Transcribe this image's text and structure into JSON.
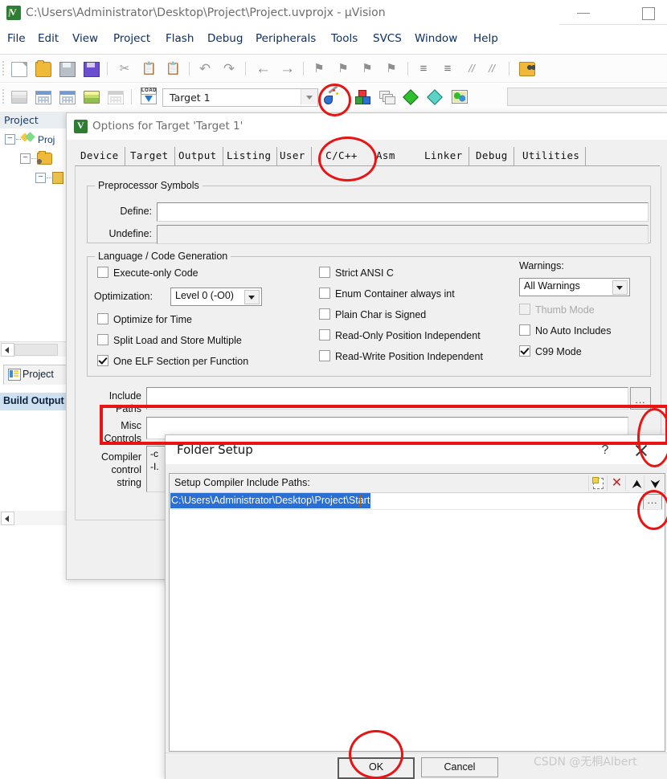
{
  "window": {
    "title": "C:\\Users\\Administrator\\Desktop\\Project\\Project.uvprojx - µVision",
    "app_icon": "uvision-logo-icon",
    "minimize": "minimize-icon",
    "maximize": "maximize-icon"
  },
  "menu": {
    "items": [
      "File",
      "Edit",
      "View",
      "Project",
      "Flash",
      "Debug",
      "Peripherals",
      "Tools",
      "SVCS",
      "Window",
      "Help"
    ]
  },
  "toolbar_top": {
    "icons": [
      "new-file-icon",
      "open-file-icon",
      "save-icon",
      "save-all-icon",
      "cut-icon",
      "copy-icon",
      "paste-icon",
      "undo-icon",
      "redo-icon",
      "navigate-back-icon",
      "navigate-forward-icon",
      "bookmark-toggle-icon",
      "bookmark-next-icon",
      "bookmark-prev-icon",
      "bookmark-clear-icon",
      "indent-icon",
      "outdent-icon",
      "comment-icon",
      "uncomment-icon",
      "find-in-files-icon"
    ]
  },
  "toolbar_second": {
    "icons": [
      "translate-icon",
      "build-icon",
      "rebuild-icon",
      "batch-build-icon",
      "stop-build-icon",
      "download-icon"
    ],
    "target_label": "Target 1",
    "target_dropdown": "chevron-down-icon",
    "right_icons": [
      "options-for-target-icon",
      "manage-project-items-icon",
      "multi-project-icon",
      "pack-installer-icon",
      "run-config-wizard-icon",
      "manage-run-time-env-icon"
    ]
  },
  "project_panel": {
    "tab_label": "Project",
    "tree": [
      {
        "label": "Proj",
        "icon": "project-icon",
        "expander": "−"
      },
      {
        "label": "",
        "icon": "folder-target-icon",
        "expander": "−"
      },
      {
        "label": "",
        "icon": "folder-group-icon",
        "expander": "−"
      }
    ],
    "bottom_tabs": [
      {
        "label": "Project",
        "icon": "project-window-icon",
        "selected": false
      },
      {
        "label": "Build Output",
        "icon": "build-output-icon",
        "selected": true
      }
    ]
  },
  "options_dialog": {
    "title": "Options for Target 'Target 1'",
    "icon": "uvision-logo-icon",
    "tabs": [
      "Device",
      "Target",
      "Output",
      "Listing",
      "User",
      "C/C++",
      "Asm",
      "Linker",
      "Debug",
      "Utilities"
    ],
    "selected_tab": "C/C++",
    "preprocessor": {
      "group_title": "Preprocessor Symbols",
      "define_label": "Define:",
      "define_value": "",
      "undefine_label": "Undefine:",
      "undefine_value": ""
    },
    "language": {
      "group_title": "Language / Code Generation",
      "left_checks": [
        {
          "label": "Execute-only Code",
          "checked": false,
          "disabled": false
        },
        {
          "label": "Optimize for Time",
          "checked": false,
          "disabled": false
        },
        {
          "label": "Split Load and Store Multiple",
          "checked": false,
          "disabled": false
        },
        {
          "label": "One ELF Section per Function",
          "checked": true,
          "disabled": false
        }
      ],
      "optimization_label": "Optimization:",
      "optimization_value": "Level 0 (-O0)",
      "middle_checks": [
        {
          "label": "Strict ANSI C",
          "checked": false,
          "disabled": false
        },
        {
          "label": "Enum Container always int",
          "checked": false,
          "disabled": false
        },
        {
          "label": "Plain Char is Signed",
          "checked": false,
          "disabled": false
        },
        {
          "label": "Read-Only Position Independent",
          "checked": false,
          "disabled": false
        },
        {
          "label": "Read-Write Position Independent",
          "checked": false,
          "disabled": false
        }
      ],
      "warnings_label": "Warnings:",
      "warnings_value": "All Warnings",
      "right_checks": [
        {
          "label": "Thumb Mode",
          "checked": false,
          "disabled": true
        },
        {
          "label": "No Auto Includes",
          "checked": false,
          "disabled": false
        },
        {
          "label": "C99 Mode",
          "checked": true,
          "disabled": false
        }
      ]
    },
    "fields": {
      "include_paths_label_1": "Include",
      "include_paths_label_2": "Paths",
      "include_paths_value": "",
      "include_paths_browse": "...",
      "misc_label_1": "Misc",
      "misc_label_2": "Controls",
      "misc_value": "",
      "compiler_label_1": "Compiler",
      "compiler_label_2": "control",
      "compiler_label_3": "string",
      "compiler_value_1": "-c",
      "compiler_value_2": "-I."
    }
  },
  "folder_dialog": {
    "title": "Folder Setup",
    "help_icon": "?",
    "close_icon": "close-icon",
    "list_header": "Setup Compiler Include Paths:",
    "header_buttons": [
      "new-path-icon",
      "delete-path-icon",
      "move-up-icon",
      "move-down-icon"
    ],
    "rows": [
      {
        "path": "C:\\Users\\Administrator\\Desktop\\Project\\Start",
        "selected": true,
        "browse": "..."
      }
    ],
    "buttons": {
      "ok": "OK",
      "cancel": "Cancel"
    }
  },
  "annotations": {
    "watermark": "CSDN @无桐Albert",
    "accent_color": "#e81313",
    "marks": [
      {
        "name": "circle-options-for-target-toolbar",
        "shape": "ellipse"
      },
      {
        "name": "circle-cpp-tab",
        "shape": "ellipse"
      },
      {
        "name": "rect-include-paths-row",
        "shape": "rect"
      },
      {
        "name": "circle-include-paths-browse",
        "shape": "ellipse"
      },
      {
        "name": "circle-path-row-browse",
        "shape": "ellipse"
      },
      {
        "name": "circle-ok-button",
        "shape": "ellipse"
      }
    ]
  }
}
